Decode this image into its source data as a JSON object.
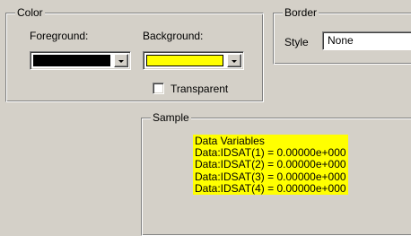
{
  "color_group": {
    "title": "Color",
    "foreground_label": "Foreground:",
    "background_label": "Background:",
    "foreground_color": "#000000",
    "background_color": "#ffff00",
    "transparent_label": "Transparent",
    "transparent_checked": false
  },
  "border_group": {
    "title": "Border",
    "style_label": "Style",
    "style_value": "None"
  },
  "sample_group": {
    "title": "Sample",
    "lines": [
      "Data Variables",
      "Data:IDSAT(1) = 0.00000e+000",
      "Data:IDSAT(2) = 0.00000e+000",
      "Data:IDSAT(3) = 0.00000e+000",
      "Data:IDSAT(4) = 0.00000e+000"
    ],
    "highlight_color": "#ffff00"
  }
}
